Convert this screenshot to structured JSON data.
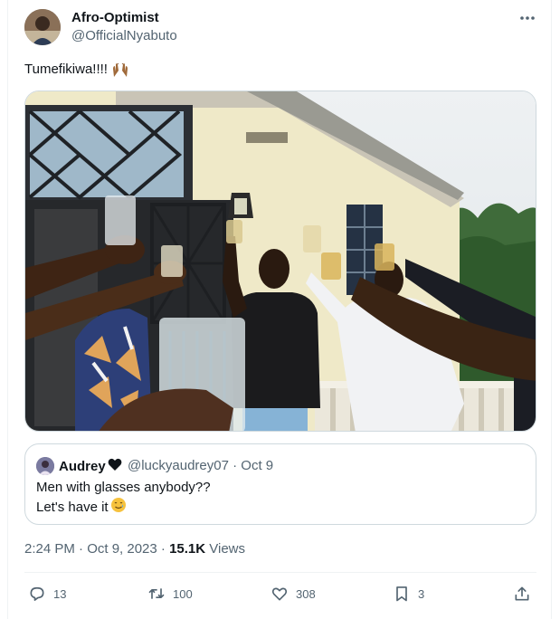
{
  "author": {
    "display_name": "Afro-Optimist",
    "handle": "@OfficialNyabuto"
  },
  "tweet": {
    "text": "Tumefikiwa!!!!",
    "emoji_icon": "raising-hands-emoji"
  },
  "quoted_tweet": {
    "name": "Audrey",
    "name_emoji_icon": "black-heart-emoji",
    "meta": "@luckyaudrey07 · Oct 9",
    "line1": "Men with glasses anybody??",
    "line2": "Let's have it",
    "line2_emoji_icon": "smiling-face-with-tear-emoji"
  },
  "timestamp": {
    "time_date": "2:24 PM · Oct 9, 2023 · ",
    "views_count": "15.1K",
    "views_label": " Views"
  },
  "actions": {
    "replies": "13",
    "retweets": "100",
    "likes": "308",
    "bookmarks": "3"
  },
  "colors": {
    "text_primary": "#0f1419",
    "text_secondary": "#536471",
    "border": "#cfd9de",
    "divider": "#eff3f4"
  }
}
